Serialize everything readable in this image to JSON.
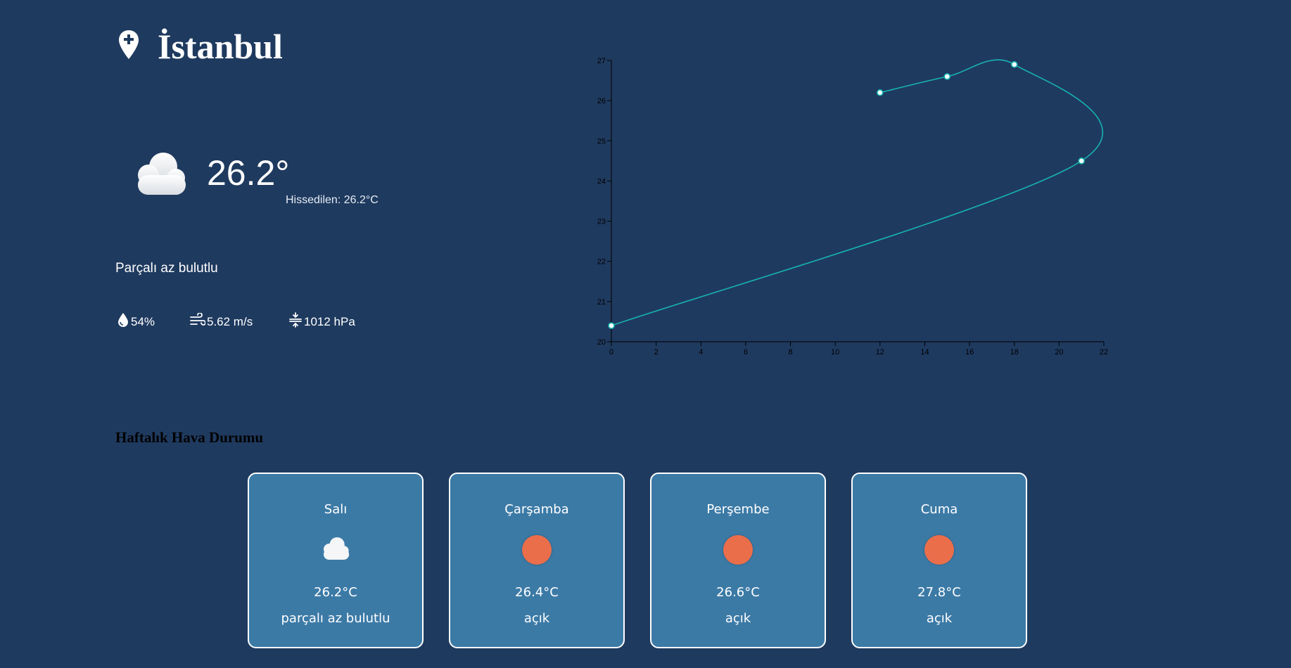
{
  "header": {
    "city": "İstanbul",
    "icon": "location-pin-plus-icon"
  },
  "current": {
    "icon": "cloud-icon",
    "temperature": "26.2°",
    "feels_like": "Hissedilen: 26.2°C",
    "description": "Parçalı az bulutlu",
    "humidity": "54%",
    "wind": "5.62 m/s",
    "pressure": "1012 hPa"
  },
  "chart_data": {
    "type": "line",
    "title": "",
    "xlabel": "",
    "ylabel": "",
    "xlim": [
      0,
      22
    ],
    "ylim": [
      20,
      27
    ],
    "x_ticks": [
      "0",
      "2",
      "4",
      "6",
      "8",
      "10",
      "12",
      "14",
      "16",
      "18",
      "20",
      "22"
    ],
    "y_ticks": [
      "20",
      "21",
      "22",
      "23",
      "24",
      "25",
      "26",
      "27"
    ],
    "series": [
      {
        "x": [
          12,
          15,
          18,
          21,
          0
        ],
        "values": [
          26.2,
          26.6,
          26.9,
          24.5,
          20.4
        ],
        "color": "#17b3b0"
      }
    ],
    "grid": false,
    "legend": "none"
  },
  "weekly": {
    "title": "Haftalık Hava Durumu",
    "days": [
      {
        "day": "Salı",
        "icon": "cloud-icon",
        "temp": "26.2°C",
        "desc": "parçalı az bulutlu"
      },
      {
        "day": "Çarşamba",
        "icon": "sun-icon",
        "temp": "26.4°C",
        "desc": "açık"
      },
      {
        "day": "Perşembe",
        "icon": "sun-icon",
        "temp": "26.6°C",
        "desc": "açık"
      },
      {
        "day": "Cuma",
        "icon": "sun-icon",
        "temp": "27.8°C",
        "desc": "açık"
      }
    ]
  },
  "colors": {
    "background": "#1f3a5f",
    "card": "#3c7aa6",
    "line": "#17b3b0",
    "sun": "#eb6e4b"
  }
}
